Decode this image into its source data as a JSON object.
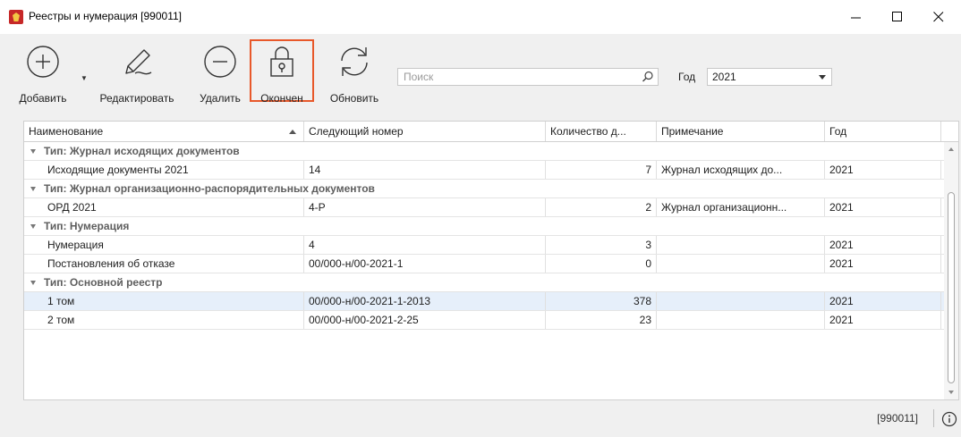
{
  "window": {
    "title": "Реестры и нумерация [990011]"
  },
  "toolbar": {
    "add_label": "Добавить",
    "edit_label": "Редактировать",
    "delete_label": "Удалить",
    "closed_label": "Окончен",
    "refresh_label": "Обновить",
    "search_placeholder": "Поиск",
    "year_label": "Год",
    "year_value": "2021"
  },
  "grid": {
    "columns": [
      "Наименование",
      "Следующий номер",
      "Количество д...",
      "Примечание",
      "Год"
    ],
    "groups": [
      {
        "title": "Тип: Журнал исходящих документов",
        "rows": [
          {
            "name": "Исходящие документы 2021",
            "next": "14",
            "count": "7",
            "note": "Журнал  исходящих до...",
            "year": "2021"
          }
        ]
      },
      {
        "title": "Тип: Журнал организационно-распорядительных документов",
        "rows": [
          {
            "name": "ОРД 2021",
            "next": "4-Р",
            "count": "2",
            "note": "Журнал организационн...",
            "year": "2021"
          }
        ]
      },
      {
        "title": "Тип: Нумерация",
        "rows": [
          {
            "name": "Нумерация",
            "next": "4",
            "count": "3",
            "note": "",
            "year": "2021"
          },
          {
            "name": "Постановления об отказе",
            "next": "00/000-н/00-2021-1",
            "count": "0",
            "note": "",
            "year": "2021"
          }
        ]
      },
      {
        "title": "Тип: Основной реестр",
        "rows": [
          {
            "name": "1 том",
            "next": "00/000-н/00-2021-1-2013",
            "count": "378",
            "note": "",
            "year": "2021"
          },
          {
            "name": "2 том",
            "next": "00/000-н/00-2021-2-25",
            "count": "23",
            "note": "",
            "year": "2021"
          }
        ]
      }
    ]
  },
  "status": {
    "id": "[990011]"
  },
  "colors": {
    "active_highlight": "#e8582a",
    "selected_row": "#e6effa",
    "group_text": "#5e5e5e"
  },
  "icons": {
    "app": "app-logo-icon",
    "add": "plus-circle-icon",
    "edit": "pencil-icon",
    "delete": "minus-circle-icon",
    "closed": "lock-icon",
    "refresh": "refresh-icon",
    "search": "search-icon",
    "info": "info-icon"
  }
}
